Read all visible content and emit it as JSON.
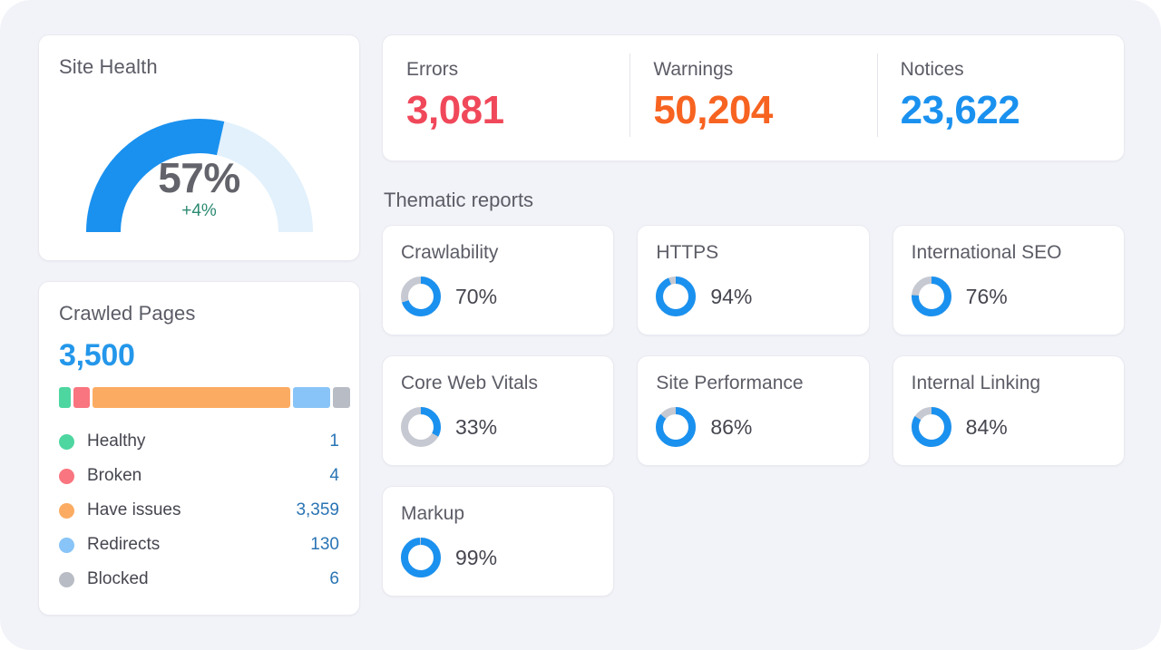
{
  "theme": {
    "page_bg": "#f2f3f8",
    "card_bg": "#ffffff",
    "accent_blue": "#1a91ef",
    "gauge_track": "#e2f1fc",
    "title_gray": "#5b5c66",
    "donut_track": "#c6c9d1"
  },
  "site_health": {
    "title": "Site Health",
    "value_label": "57%",
    "value": 57,
    "delta_label": "+4%",
    "arc_color": "#1a91ef",
    "track_color": "#e2f1fc",
    "delta_color": "#2c8a72"
  },
  "crawled_pages": {
    "title": "Crawled Pages",
    "total_label": "3,500",
    "total": 3500,
    "segments": [
      {
        "name": "Healthy",
        "value": 1,
        "value_label": "1",
        "color": "#4ed6a0",
        "bar_weight": 4.2
      },
      {
        "name": "Broken",
        "value": 4,
        "value_label": "4",
        "color": "#f9757f",
        "bar_weight": 5.5
      },
      {
        "name": "Have issues",
        "value": 3359,
        "value_label": "3,359",
        "color": "#fbac62",
        "bar_weight": 68.5
      },
      {
        "name": "Redirects",
        "value": 130,
        "value_label": "130",
        "color": "#88c4f7",
        "bar_weight": 12.8
      },
      {
        "name": "Blocked",
        "value": 6,
        "value_label": "6",
        "color": "#b8bcc4",
        "bar_weight": 6.0
      }
    ]
  },
  "issues": [
    {
      "label": "Errors",
      "value_label": "3,081",
      "value": 3081,
      "color": "#f0485a"
    },
    {
      "label": "Warnings",
      "value_label": "50,204",
      "value": 50204,
      "color": "#f76321"
    },
    {
      "label": "Notices",
      "value_label": "23,622",
      "value": 23622,
      "color": "#1a91ef"
    }
  ],
  "thematic": {
    "section_title": "Thematic reports",
    "reports": [
      {
        "title": "Crawlability",
        "pct_label": "70%",
        "value": 70
      },
      {
        "title": "HTTPS",
        "pct_label": "94%",
        "value": 94
      },
      {
        "title": "International SEO",
        "pct_label": "76%",
        "value": 76
      },
      {
        "title": "Core Web Vitals",
        "pct_label": "33%",
        "value": 33
      },
      {
        "title": "Site Performance",
        "pct_label": "86%",
        "value": 86
      },
      {
        "title": "Internal Linking",
        "pct_label": "84%",
        "value": 84
      },
      {
        "title": "Markup",
        "pct_label": "99%",
        "value": 99
      }
    ]
  },
  "chart_data": [
    {
      "type": "gauge",
      "title": "Site Health",
      "value": 57,
      "unit": "%",
      "range": [
        0,
        100
      ],
      "delta": "+4%",
      "arc_span_degrees": 180,
      "fill_color": "#1a91ef",
      "track_color": "#e2f1fc"
    },
    {
      "type": "bar",
      "title": "Crawled Pages",
      "subtype": "stacked-horizontal",
      "total": 3500,
      "categories": [
        "Healthy",
        "Broken",
        "Have issues",
        "Redirects",
        "Blocked"
      ],
      "values": [
        1,
        4,
        3359,
        130,
        6
      ],
      "colors": [
        "#4ed6a0",
        "#f9757f",
        "#fbac62",
        "#88c4f7",
        "#b8bcc4"
      ],
      "legend": "bottom-list",
      "xlabel": "",
      "ylabel": ""
    },
    {
      "type": "table",
      "title": "Issues summary",
      "columns": [
        "Errors",
        "Warnings",
        "Notices"
      ],
      "values": [
        3081,
        50204,
        23622
      ]
    },
    {
      "type": "pie",
      "subtype": "donut-set",
      "title": "Thematic reports",
      "categories": [
        "Crawlability",
        "HTTPS",
        "International SEO",
        "Core Web Vitals",
        "Site Performance",
        "Internal Linking",
        "Markup"
      ],
      "values": [
        70,
        94,
        76,
        33,
        86,
        84,
        99
      ],
      "unit": "%",
      "ylim": [
        0,
        100
      ],
      "fill_color": "#1a91ef",
      "track_color": "#c6c9d1"
    }
  ]
}
